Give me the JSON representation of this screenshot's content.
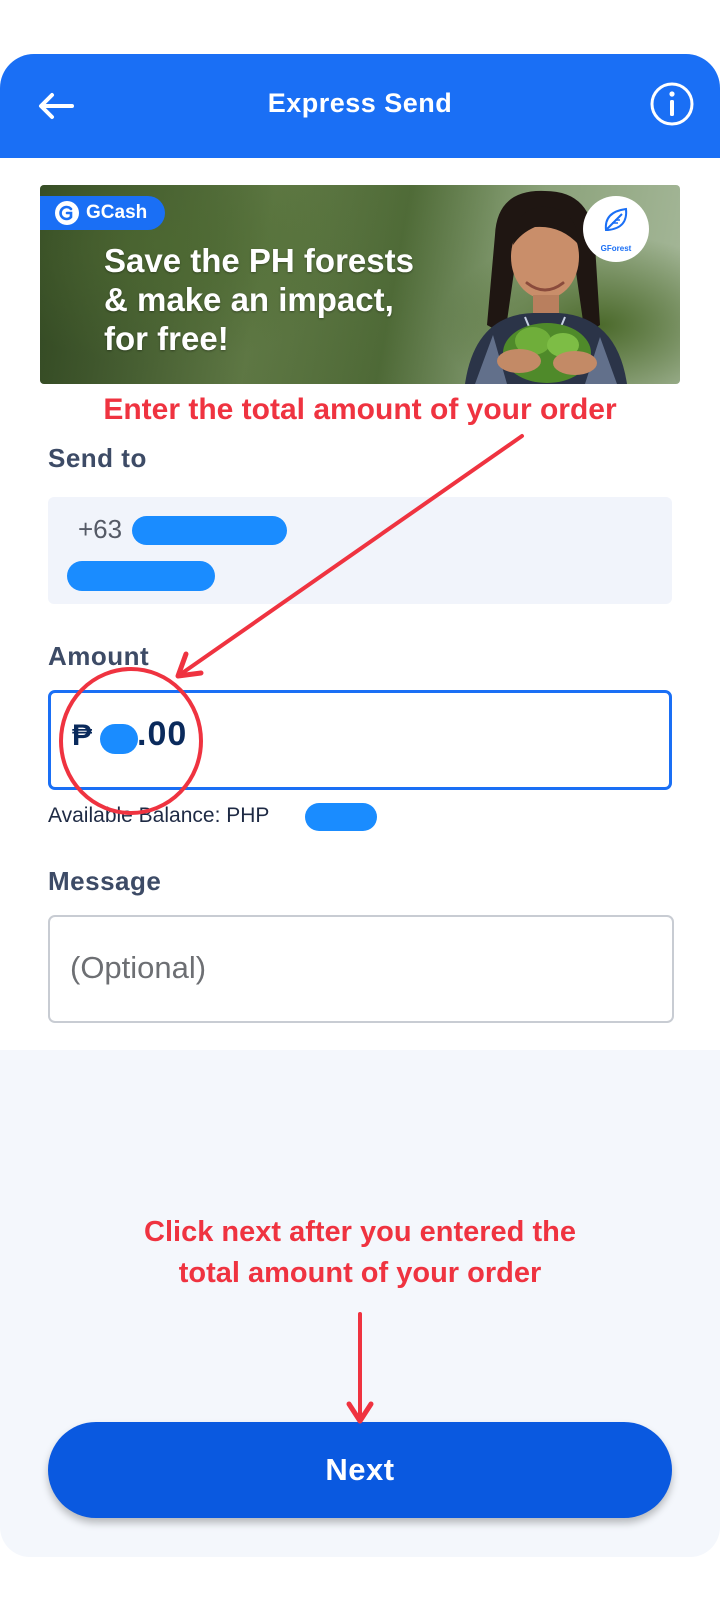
{
  "header": {
    "title": "Express Send",
    "back_icon": "arrow-left-icon",
    "info_icon": "info-circle-icon",
    "color": "#1a6ff5"
  },
  "banner": {
    "brand": "GCash",
    "headline_lines": [
      "Save the PH forests",
      "& make an impact,",
      "for free!"
    ],
    "badge_label": "GForest"
  },
  "annotations": {
    "top": "Enter the total amount of your order",
    "bottom_lines": [
      "Click next after you entered the",
      "total amount of your order"
    ],
    "color": "#ef3340"
  },
  "send_to": {
    "label": "Send to",
    "phone_prefix": "+63"
  },
  "amount": {
    "label": "Amount",
    "currency_symbol": "₱",
    "value_suffix": ".00",
    "balance_label": "Available Balance: PHP"
  },
  "message": {
    "label": "Message",
    "placeholder": "(Optional)"
  },
  "footer": {
    "next_label": "Next",
    "button_color": "#0a59e0"
  }
}
